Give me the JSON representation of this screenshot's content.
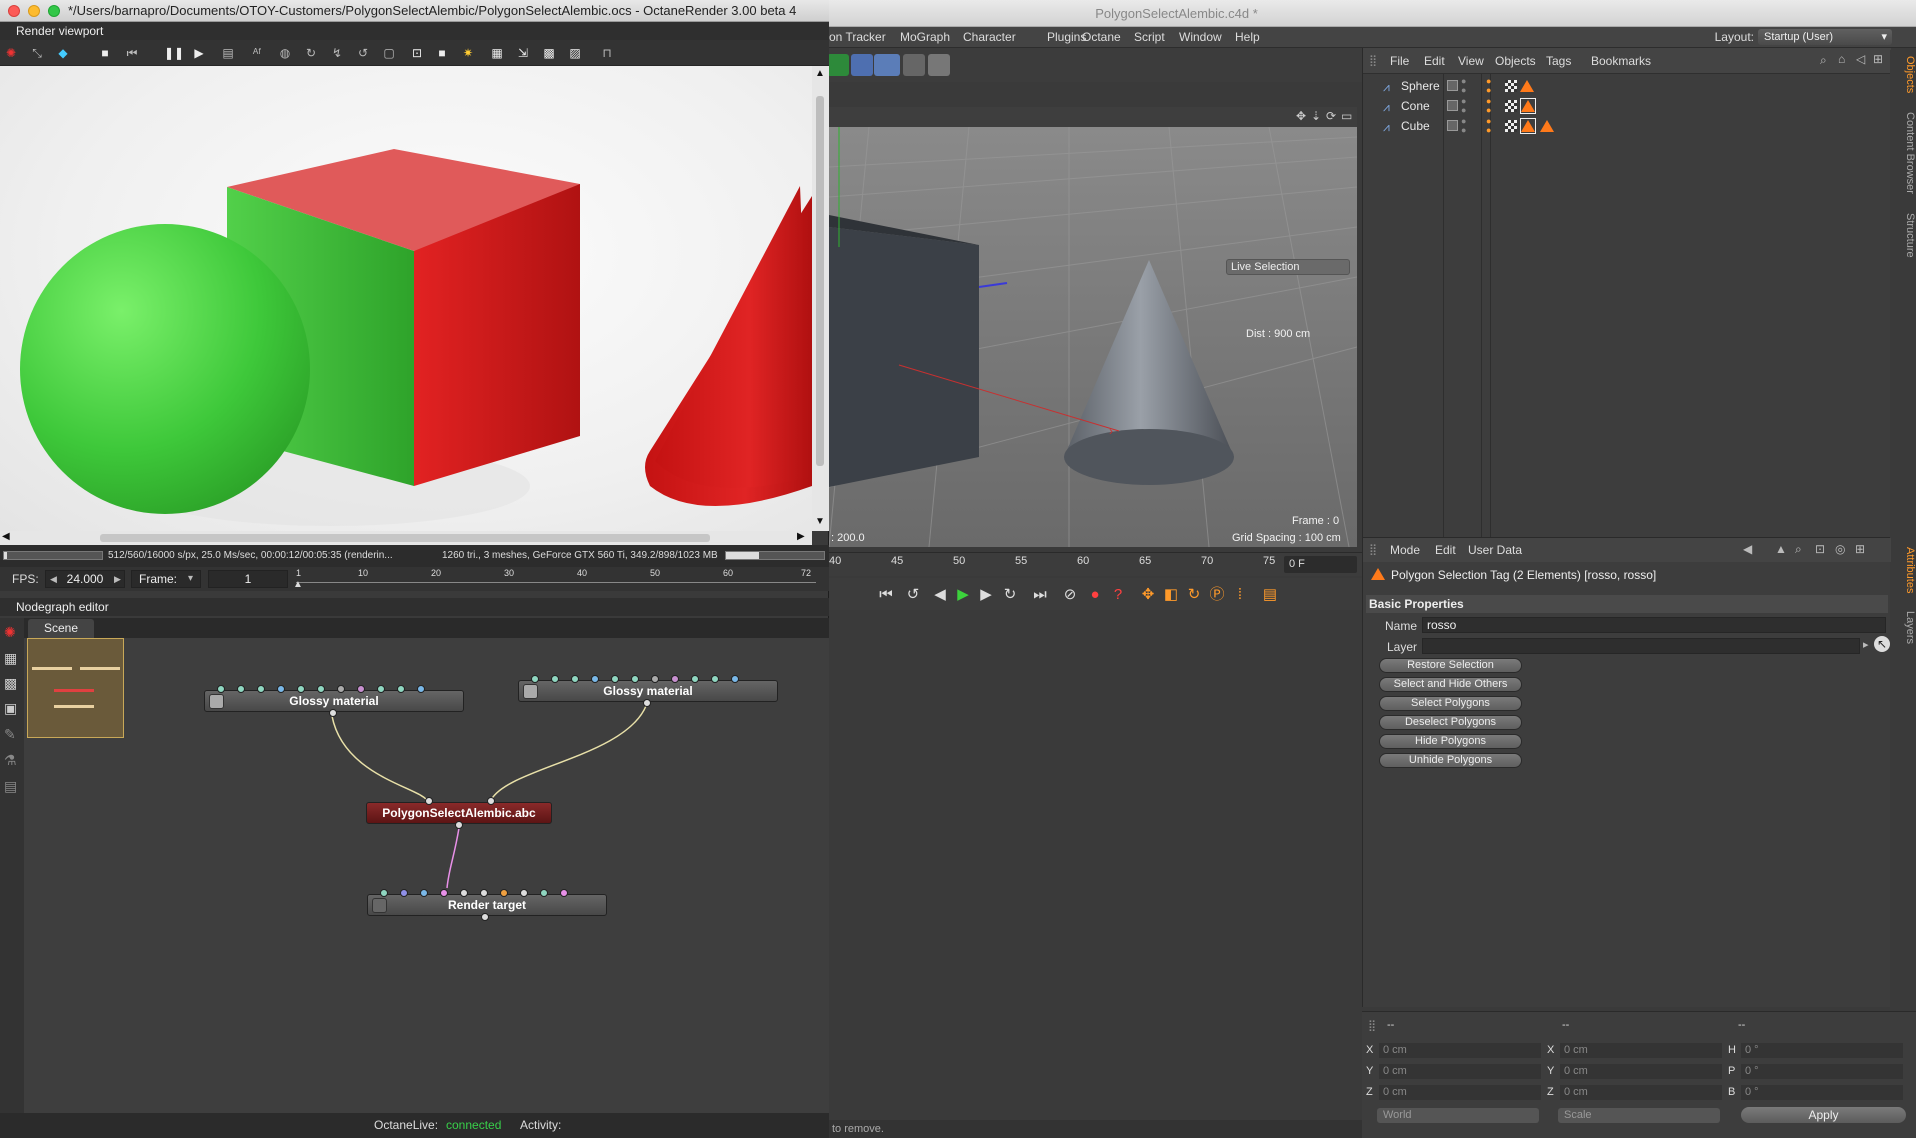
{
  "c4d": {
    "window_title": "PolygonSelectAlembic.c4d *",
    "menu": [
      "on Tracker",
      "MoGraph",
      "Character",
      "Plugins",
      "Octane",
      "Script",
      "Window",
      "Help"
    ],
    "layout_label": "Layout:",
    "layout_value": "Startup (User)",
    "viewport": {
      "live_selection": "Live Selection",
      "dist": "Dist : 900 cm",
      "frame": "Frame : 0",
      "grid_spacing": "Grid Spacing : 100 cm",
      "coord_left": ": 200.0"
    },
    "timeline": {
      "ticks": [
        "40",
        "45",
        "50",
        "55",
        "60",
        "65",
        "70",
        "75"
      ],
      "frame_field": "0 F"
    },
    "status": "to remove."
  },
  "objects": {
    "menu": [
      "File",
      "Edit",
      "View",
      "Objects",
      "Tags",
      "Bookmarks"
    ],
    "items": [
      {
        "name": "Sphere"
      },
      {
        "name": "Cone"
      },
      {
        "name": "Cube"
      }
    ]
  },
  "side_tabs": {
    "top": [
      "Objects",
      "Content Browser",
      "Structure"
    ],
    "bottom": [
      "Attributes",
      "Layers"
    ]
  },
  "attributes": {
    "menu": [
      "Mode",
      "Edit",
      "User Data"
    ],
    "header": "Polygon Selection Tag (2 Elements) [rosso, rosso]",
    "section": "Basic Properties",
    "name_label": "Name",
    "name_value": "rosso",
    "layer_label": "Layer",
    "layer_value": "",
    "buttons": [
      "Restore Selection",
      "Select and Hide Others",
      "Select Polygons",
      "Deselect Polygons",
      "Hide Polygons",
      "Unhide Polygons"
    ]
  },
  "coords": {
    "headers": [
      "--",
      "--",
      "--"
    ],
    "rows": [
      {
        "l1": "X",
        "v1": "0 cm",
        "l2": "X",
        "v2": "0 cm",
        "l3": "H",
        "v3": "0 °"
      },
      {
        "l1": "Y",
        "v1": "0 cm",
        "l2": "Y",
        "v2": "0 cm",
        "l3": "P",
        "v3": "0 °"
      },
      {
        "l1": "Z",
        "v1": "0 cm",
        "l2": "Z",
        "v2": "0 cm",
        "l3": "B",
        "v3": "0 °"
      }
    ],
    "world": "World",
    "scale": "Scale",
    "apply": "Apply"
  },
  "octane": {
    "window_title": "*/Users/barnapro/Documents/OTOY-Customers/PolygonSelectAlembic/PolygonSelectAlembic.ocs - OctaneRender 3.00 beta 4",
    "render_viewport_label": "Render viewport",
    "status_left": "512/560/16000 s/px, 25.0 Ms/sec, 00:00:12/00:05:35 (renderin...",
    "status_right": "1260 tri., 3 meshes, GeForce GTX 560 Ti, 349.2/898/1023 MB",
    "fps_label": "FPS:",
    "fps_value": "24.000",
    "frame_label": "Frame:",
    "frame_value": "1",
    "ruler_ticks": [
      "1",
      "10",
      "20",
      "30",
      "40",
      "50",
      "60",
      "72"
    ],
    "nodegraph_label": "Nodegraph editor",
    "scene_tab": "Scene",
    "nodes": {
      "glossy1": "Glossy material",
      "glossy2": "Glossy material",
      "alembic": "PolygonSelectAlembic.abc",
      "render_target": "Render target"
    },
    "footer_live_label": "OctaneLive:",
    "footer_live_status": "connected",
    "footer_activity": "Activity:",
    "colors": {
      "connected": "#38d04a",
      "glossy_green": "#3ec83a",
      "glossy_red": "#d91818"
    }
  }
}
